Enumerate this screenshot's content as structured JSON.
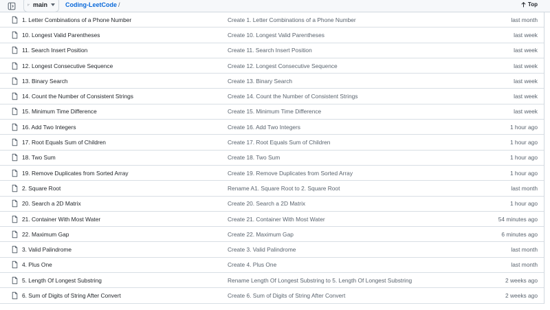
{
  "header": {
    "branch_label": "main",
    "repo_name": "Coding-LeetCode",
    "separator": "/",
    "top_label": "Top"
  },
  "files": [
    {
      "name": "1. Letter Combinations of a Phone Number",
      "commit": "Create 1. Letter Combinations of a Phone Number",
      "age": "last month"
    },
    {
      "name": "10. Longest Valid Parentheses",
      "commit": "Create 10. Longest Valid Parentheses",
      "age": "last week"
    },
    {
      "name": "11. Search Insert Position",
      "commit": "Create 11. Search Insert Position",
      "age": "last week"
    },
    {
      "name": "12. Longest Consecutive Sequence",
      "commit": "Create 12. Longest Consecutive Sequence",
      "age": "last week"
    },
    {
      "name": "13. Binary Search",
      "commit": "Create 13. Binary Search",
      "age": "last week"
    },
    {
      "name": "14. Count the Number of Consistent Strings",
      "commit": "Create 14. Count the Number of Consistent Strings",
      "age": "last week"
    },
    {
      "name": "15. Minimum Time Difference",
      "commit": "Create 15. Minimum Time Difference",
      "age": "last week"
    },
    {
      "name": "16. Add Two Integers",
      "commit": "Create 16. Add Two Integers",
      "age": "1 hour ago"
    },
    {
      "name": "17. Root Equals Sum of Children",
      "commit": "Create 17. Root Equals Sum of Children",
      "age": "1 hour ago"
    },
    {
      "name": "18. Two Sum",
      "commit": "Create 18. Two Sum",
      "age": "1 hour ago"
    },
    {
      "name": "19. Remove Duplicates from Sorted Array",
      "commit": "Create 19. Remove Duplicates from Sorted Array",
      "age": "1 hour ago"
    },
    {
      "name": "2. Square Root",
      "commit": "Rename A1. Square Root to 2. Square Root",
      "age": "last month"
    },
    {
      "name": "20. Search a 2D Matrix",
      "commit": "Create 20. Search a 2D Matrix",
      "age": "1 hour ago"
    },
    {
      "name": "21. Container With Most Water",
      "commit": "Create 21. Container With Most Water",
      "age": "54 minutes ago"
    },
    {
      "name": "22. Maximum Gap",
      "commit": "Create 22. Maximum Gap",
      "age": "6 minutes ago"
    },
    {
      "name": "3. Valid Palindrome",
      "commit": "Create 3. Valid Palindrome",
      "age": "last month"
    },
    {
      "name": "4. Plus One",
      "commit": "Create 4. Plus One",
      "age": "last month"
    },
    {
      "name": "5. Length Of Longest Substring",
      "commit": "Rename Length Of Longest Substring to 5. Length Of Longest Substring",
      "age": "2 weeks ago"
    },
    {
      "name": "6. Sum of Digits of String After Convert",
      "commit": "Create 6. Sum of Digits of String After Convert",
      "age": "2 weeks ago"
    }
  ]
}
